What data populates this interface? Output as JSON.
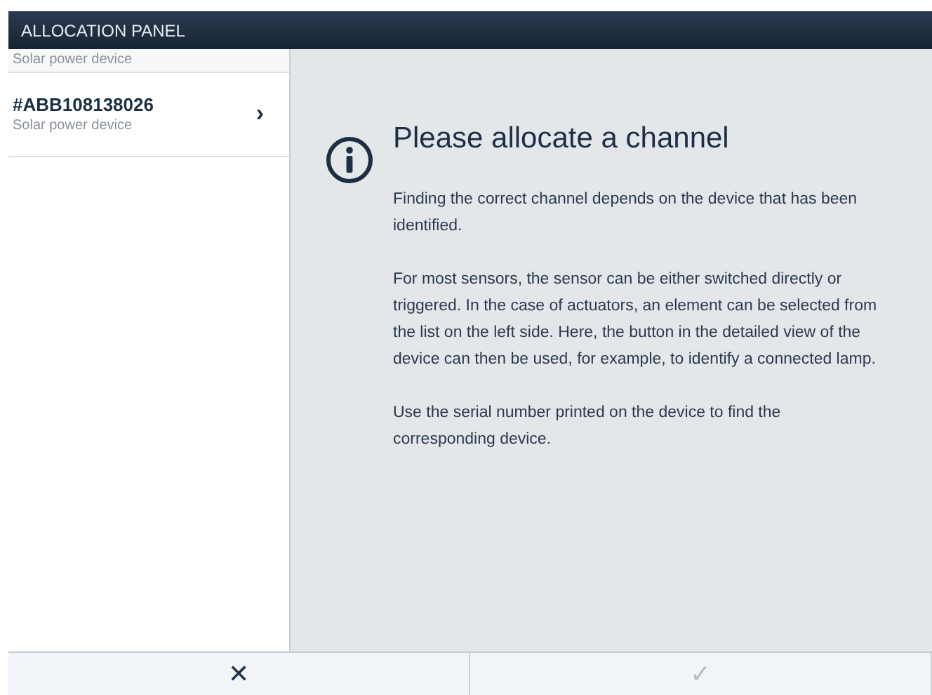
{
  "header": {
    "title": "ALLOCATION PANEL"
  },
  "sidebar": {
    "section_label": "Solar power device",
    "items": [
      {
        "title": "#ABB108138026",
        "subtitle": "Solar power device",
        "chevron": "›",
        "selected": false
      }
    ]
  },
  "message": {
    "title": "Please allocate a channel",
    "paragraphs": [
      "Finding the correct channel depends on the device that has been identified.",
      "For most sensors, the sensor can be either switched directly or triggered. In the case of actuators, an element can be selected from the list on the left side. Here, the button in the detailed view of the device can then be used, for example, to identify a connected lamp.",
      "Use the serial number printed on the device to find the corresponding device."
    ]
  },
  "buttons": [
    {
      "label": "✕",
      "disabled": false
    },
    {
      "label": "✓",
      "disabled": true
    }
  ]
}
